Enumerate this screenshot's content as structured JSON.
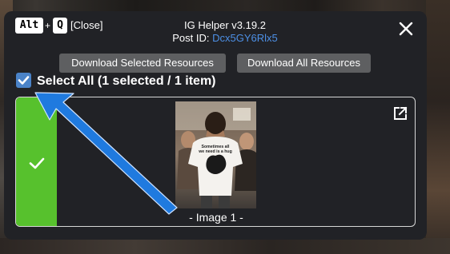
{
  "shortcut": {
    "key1": "Alt",
    "plus": "+",
    "key2": "Q",
    "close_label": "[Close]"
  },
  "header": {
    "title": "IG Helper v3.19.2",
    "post_id_label": "Post ID: ",
    "post_id": "Dcx5GY6Rlx5"
  },
  "toolbar": {
    "download_selected_label": "Download Selected Resources",
    "download_all_label": "Download All Resources"
  },
  "select_all": {
    "checked": true,
    "label": "Select All (1 selected / 1 item)"
  },
  "items": [
    {
      "selected": true,
      "caption": "- Image 1 -",
      "shirt_text": "Sometimes all we need is a hug"
    }
  ],
  "icons": {
    "close": "close-icon",
    "checkbox": "checkbox-checked-icon",
    "selected_check": "checkmark-icon",
    "open_in_new": "open-in-new-icon",
    "annotation_arrow": "arrow-annotation"
  },
  "colors": {
    "panel_bg": "#212226",
    "link": "#4d90e6",
    "checkbox": "#4a83c8",
    "selected_bar": "#57c12d",
    "button_bg": "#5e5f61",
    "arrow": "#1f7adf"
  }
}
